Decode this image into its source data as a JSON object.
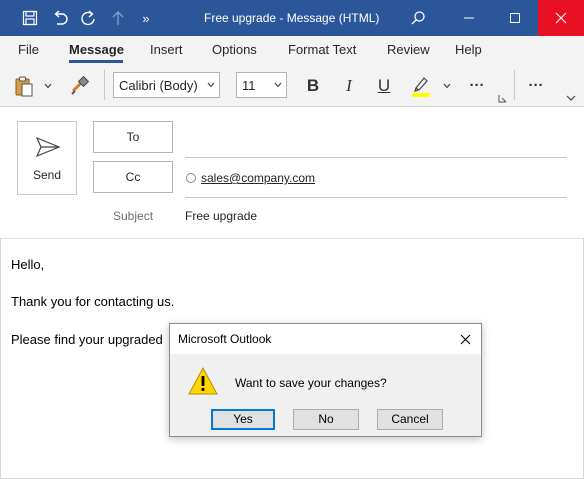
{
  "window": {
    "title": "Free upgrade  -  Message (HTML)",
    "icons": [
      "save-icon",
      "undo-icon",
      "redo-icon",
      "up-arrow-icon",
      "more-commands-icon",
      "search-icon",
      "minimize-icon",
      "maximize-icon",
      "close-icon"
    ],
    "accent_color": "#2b579a",
    "close_color": "#e81123"
  },
  "menu": {
    "items": [
      "File",
      "Message",
      "Insert",
      "Options",
      "Format Text",
      "Review",
      "Help"
    ],
    "active": "Message"
  },
  "ribbon": {
    "font_name": "Calibri (Body)",
    "font_size": "11",
    "bold": "B",
    "italic": "I",
    "underline": "U",
    "more": "···",
    "highlight_color": "#ffff00"
  },
  "compose": {
    "send_label": "Send",
    "to_label": "To",
    "cc_label": "Cc",
    "cc_recipient": "sales@company.com",
    "subject_label": "Subject",
    "subject_value": "Free upgrade"
  },
  "body": {
    "lines": [
      "Hello,",
      "Thank you for contacting us.",
      "Please find your upgraded"
    ]
  },
  "dialog": {
    "title": "Microsoft Outlook",
    "message": "Want to save your changes?",
    "icon": "warning-icon",
    "yes_label": "Yes",
    "no_label": "No",
    "cancel_label": "Cancel"
  }
}
